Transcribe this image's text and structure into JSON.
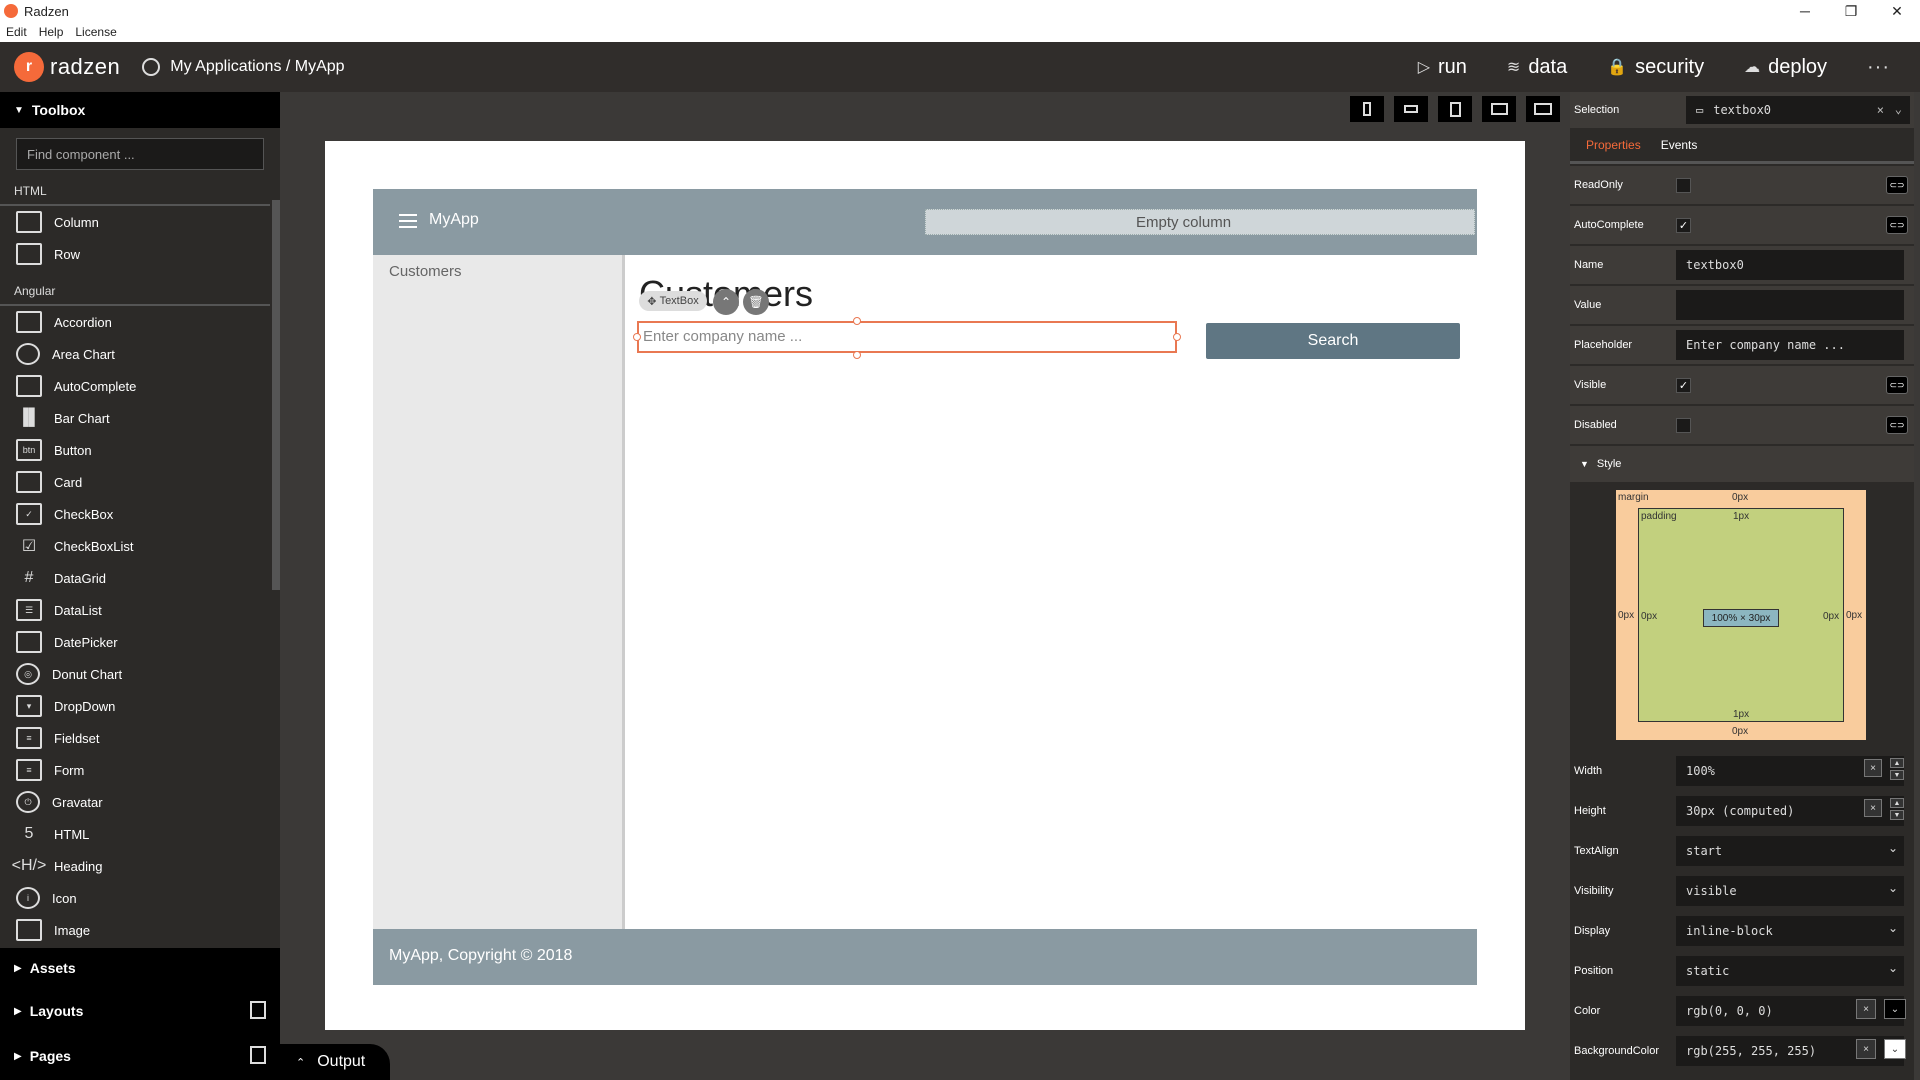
{
  "window": {
    "title": "Radzen",
    "controls": [
      "─",
      "❐",
      "✕"
    ]
  },
  "menubar": {
    "items": [
      "Edit",
      "Help",
      "License"
    ]
  },
  "header": {
    "brand": "radzen",
    "breadcrumb": "My Applications / MyApp",
    "nav": [
      {
        "label": "run",
        "icon": "▷"
      },
      {
        "label": "data",
        "icon": "≋"
      },
      {
        "label": "security",
        "icon": "🔒"
      },
      {
        "label": "deploy",
        "icon": "☁"
      }
    ],
    "more": "···"
  },
  "toolbox": {
    "title": "Toolbox",
    "search_placeholder": "Find component ...",
    "groups": [
      {
        "label": "HTML",
        "items": [
          "Column",
          "Row"
        ]
      },
      {
        "label": "Angular",
        "items": [
          "Accordion",
          "Area Chart",
          "AutoComplete",
          "Bar Chart",
          "Button",
          "Card",
          "CheckBox",
          "CheckBoxList",
          "DataGrid",
          "DataList",
          "DatePicker",
          "Donut Chart",
          "DropDown",
          "Fieldset",
          "Form",
          "Gravatar",
          "HTML",
          "Heading",
          "Icon",
          "Image"
        ]
      }
    ],
    "sections": [
      "Assets",
      "Layouts",
      "Pages"
    ]
  },
  "canvas": {
    "app_title": "MyApp",
    "empty_column": "Empty column",
    "side_link": "Customers",
    "heading": "Customers",
    "chip": "TextBox",
    "textbox_placeholder": "Enter company name ...",
    "search_button": "Search",
    "footer": "MyApp, Copyright © 2018"
  },
  "output": {
    "label": "Output"
  },
  "properties": {
    "selection_label": "Selection",
    "selection_value": "textbox0",
    "tabs": [
      "Properties",
      "Events"
    ],
    "rows": [
      {
        "label": "ReadOnly",
        "type": "check",
        "checked": false
      },
      {
        "label": "AutoComplete",
        "type": "check",
        "checked": true
      },
      {
        "label": "Name",
        "type": "text",
        "value": "textbox0"
      },
      {
        "label": "Value",
        "type": "text",
        "value": ""
      },
      {
        "label": "Placeholder",
        "type": "text",
        "value": "Enter company name ..."
      },
      {
        "label": "Visible",
        "type": "check",
        "checked": true
      },
      {
        "label": "Disabled",
        "type": "check",
        "checked": false
      }
    ],
    "style_label": "Style",
    "boxmodel": {
      "margin_label": "margin",
      "padding_label": "padding",
      "margin_top": "0px",
      "margin_bottom": "0px",
      "margin_left": "0px",
      "margin_right": "0px",
      "padding_top": "1px",
      "padding_bottom": "1px",
      "padding_left": "0px",
      "padding_right": "0px",
      "content": "100% × 30px"
    },
    "style_rows": [
      {
        "label": "Width",
        "value": "100%",
        "kind": "spin"
      },
      {
        "label": "Height",
        "value": "30px (computed)",
        "kind": "spin"
      },
      {
        "label": "TextAlign",
        "value": "start",
        "kind": "select"
      },
      {
        "label": "Visibility",
        "value": "visible",
        "kind": "select"
      },
      {
        "label": "Display",
        "value": "inline-block",
        "kind": "select"
      },
      {
        "label": "Position",
        "value": "static",
        "kind": "select"
      },
      {
        "label": "Color",
        "value": "rgb(0, 0, 0)",
        "kind": "color",
        "swatch": "#000000"
      },
      {
        "label": "BackgroundColor",
        "value": "rgb(255, 255, 255)",
        "kind": "color",
        "swatch": "#ffffff"
      }
    ]
  },
  "colors": {
    "accent": "#f56a3a",
    "app_bar": "#8a9aa2",
    "button": "#5f7683"
  }
}
